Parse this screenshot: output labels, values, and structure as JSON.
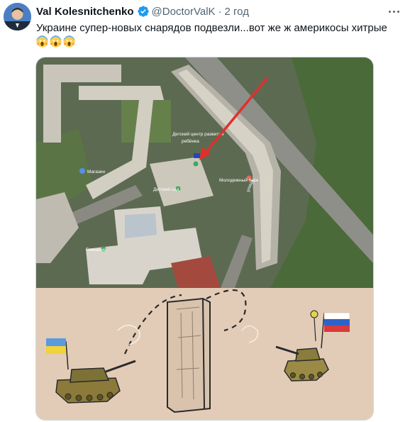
{
  "tweet": {
    "author_name": "Val Kolesnitchenko",
    "handle": "@DoctorValK",
    "separator": "·",
    "time": "2 год",
    "text": "Украине супер-новых снарядов подвезли...вот же ж америкосы хитрые",
    "emojis": [
      "face-screaming-in-fear",
      "face-screaming-in-fear",
      "face-screaming-in-fear"
    ]
  },
  "media": {
    "map_labels": {
      "center_label": "Детский центр развития",
      "center_label_2": "ребёнка",
      "park_label": "Молодежный парк",
      "left_label": "Магазин",
      "green_label": "Детский сад",
      "bottom_label": "Гимназия",
      "road_label": "улица"
    }
  },
  "colors": {
    "verified": "#1d9bf0",
    "arrow": "#e0302c",
    "handle": "#536471"
  }
}
